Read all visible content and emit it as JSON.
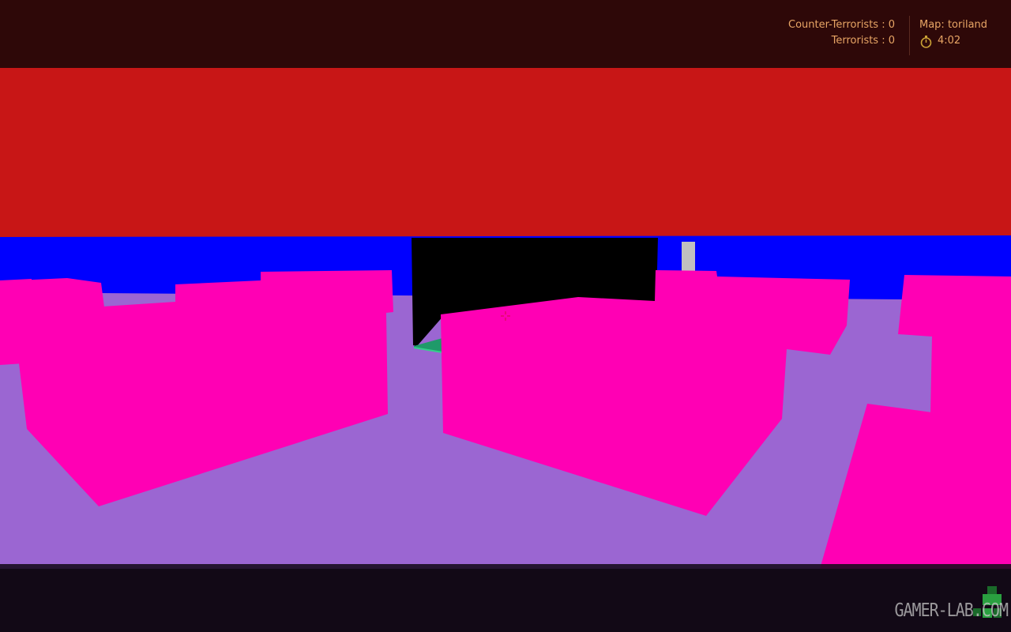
{
  "scoreboard": {
    "ct_label": "Counter-Terrorists : 0",
    "t_label": "Terrorists : 0",
    "ct_score": 0,
    "t_score": 0
  },
  "map_info": {
    "map_label": "Map: toriland",
    "map_name": "toriland",
    "time_remaining": "4:02"
  },
  "watermark": {
    "text": "GAMER-LAB.COM"
  },
  "colors": {
    "sky_ceiling": "#c81616",
    "far_wall": "#0000ff",
    "blocks": "#ff00b4",
    "floor": "#9b66d2",
    "dark_wall": "#000000",
    "hud_text": "#e8a565",
    "hud_bar": "#2e0808"
  },
  "icons": {
    "timer": "stopwatch-icon",
    "crosshair": "crosshair-icon",
    "logo": "gamer-lab-logo-icon"
  }
}
